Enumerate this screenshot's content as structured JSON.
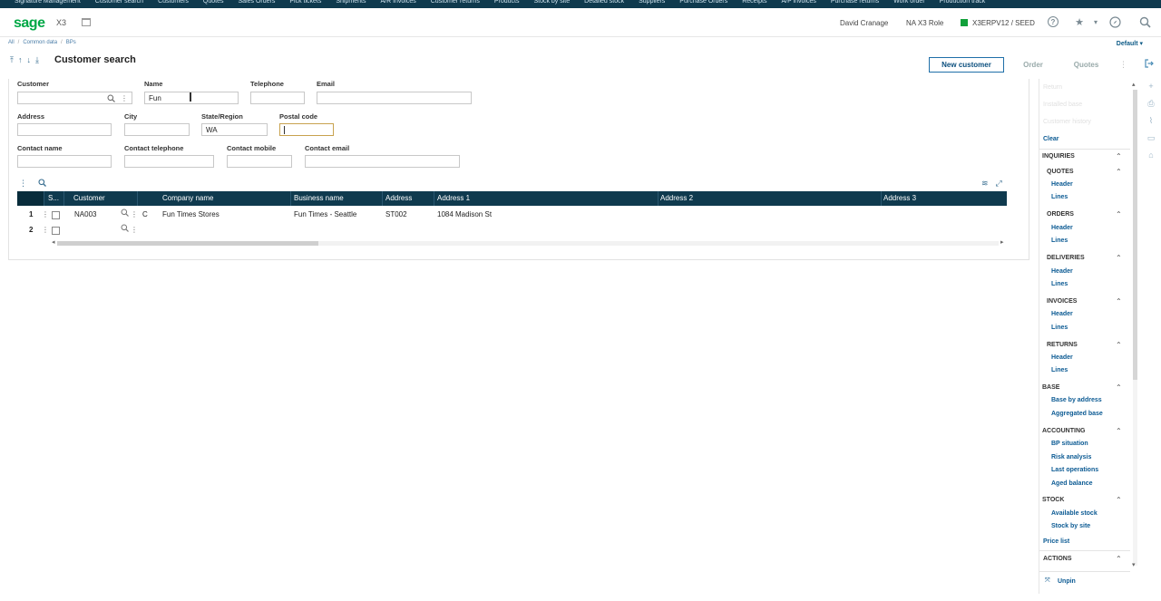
{
  "top_menu": [
    "Signature Management",
    "Customer search",
    "Customers",
    "Quotes",
    "Sales Orders",
    "Pick tickets",
    "Shipments",
    "A/R Invoices",
    "Customer returns",
    "Products",
    "Stock by site",
    "Detailed stock",
    "Suppliers",
    "Purchase Orders",
    "Receipts",
    "A/P invoices",
    "Purchase returns",
    "Work order",
    "Production track"
  ],
  "appbar": {
    "logo": "sage",
    "product": "X3",
    "user": "David Cranage",
    "role": "NA X3 Role",
    "folder": "X3ERPV12 / SEED"
  },
  "breadcrumb": [
    "All",
    "Common data",
    "BPs"
  ],
  "default_label": "Default",
  "page": {
    "title": "Customer search",
    "new_customer": "New customer",
    "order": "Order",
    "quotes": "Quotes"
  },
  "form": {
    "customer_label": "Customer",
    "customer_value": "",
    "name_label": "Name",
    "name_value": "Fun",
    "telephone_label": "Telephone",
    "telephone_value": "",
    "email_label": "Email",
    "email_value": "",
    "address_label": "Address",
    "address_value": "",
    "city_label": "City",
    "city_value": "",
    "state_label": "State/Region",
    "state_value": "WA",
    "postal_label": "Postal code",
    "postal_value": "",
    "contact_name_label": "Contact name",
    "contact_name_value": "",
    "contact_tel_label": "Contact telephone",
    "contact_tel_value": "",
    "contact_mobile_label": "Contact mobile",
    "contact_mobile_value": "",
    "contact_email_label": "Contact email",
    "contact_email_value": ""
  },
  "grid": {
    "headers": {
      "s": "S...",
      "customer": "Customer",
      "company": "Company name",
      "business": "Business name",
      "address": "Address",
      "address1": "Address 1",
      "address2": "Address 2",
      "address3": "Address 3"
    },
    "rows": [
      {
        "num": "1",
        "customer": "NA003",
        "s": "C",
        "company": "Fun Times Stores",
        "business": "Fun Times - Seattle",
        "address": "ST002",
        "address1": "1084 Madison St"
      },
      {
        "num": "2",
        "customer": "",
        "s": "",
        "company": "",
        "business": "",
        "address": "",
        "address1": ""
      }
    ]
  },
  "rpanel": {
    "faded": [
      "Return",
      "Installed base",
      "Customer history"
    ],
    "clear": "Clear",
    "inquiries": "INQUIRIES",
    "quotes": "QUOTES",
    "orders": "ORDERS",
    "deliveries": "DELIVERIES",
    "invoices": "INVOICES",
    "returns": "RETURNS",
    "header": "Header",
    "lines": "Lines",
    "base": "BASE",
    "base_by_address": "Base by address",
    "aggregated_base": "Aggregated base",
    "accounting": "ACCOUNTING",
    "bp_situation": "BP situation",
    "risk_analysis": "Risk analysis",
    "last_operations": "Last operations",
    "aged_balance": "Aged balance",
    "stock": "STOCK",
    "available_stock": "Available stock",
    "stock_by_site": "Stock by site",
    "price_list": "Price list",
    "actions": "ACTIONS",
    "unpin": "Unpin"
  }
}
